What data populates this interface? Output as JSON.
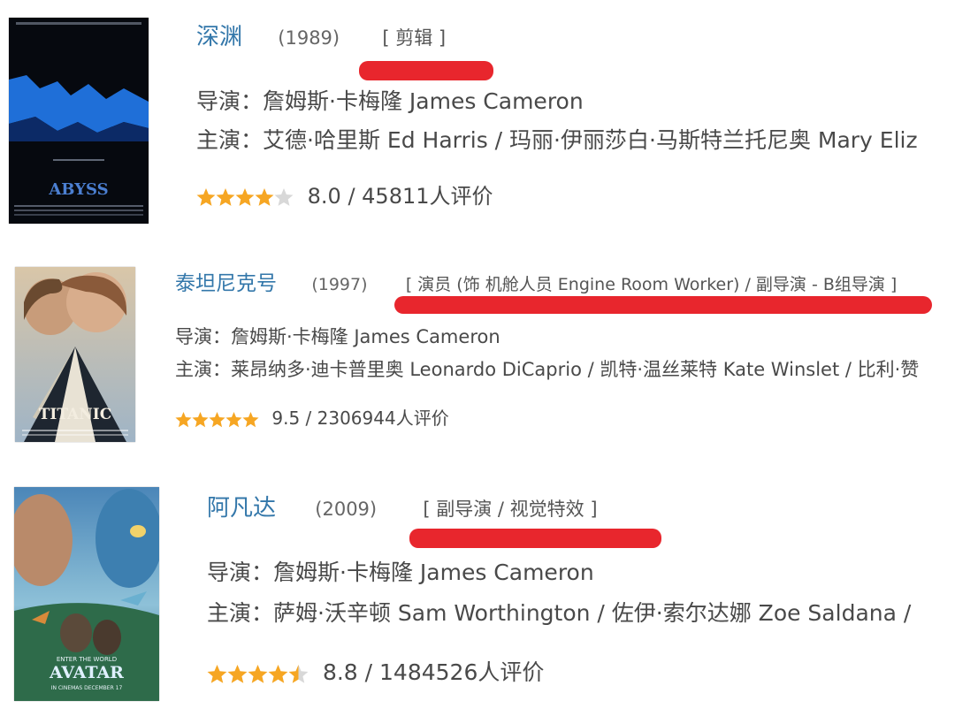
{
  "colors": {
    "title_link": "#3377aa",
    "star": "#f6a623",
    "star_empty": "#d8d8d8",
    "highlight": "#e8262d"
  },
  "movies": [
    {
      "title": "深渊",
      "year": "(1989)",
      "roles": "[ 剪辑 ]",
      "director_label": "导演：",
      "director": "詹姆斯·卡梅隆 James Cameron",
      "cast_label": "主演：",
      "cast": "艾德·哈里斯 Ed Harris / 玛丽·伊丽莎白·马斯特兰托尼奥 Mary Eliz",
      "rating_text": "8.0 / 45811人评价",
      "stars": 4,
      "poster_title": "ABYSS"
    },
    {
      "title": "泰坦尼克号",
      "year": "(1997)",
      "roles": "[ 演员 (饰 机舱人员 Engine Room Worker) / 副导演 - B组导演 ]",
      "director_label": "导演：",
      "director": "詹姆斯·卡梅隆 James Cameron",
      "cast_label": "主演：",
      "cast": "莱昂纳多·迪卡普里奥 Leonardo DiCaprio / 凯特·温丝莱特 Kate Winslet / 比利·赞",
      "rating_text": "9.5 / 2306944人评价",
      "stars": 5,
      "poster_title": "TITANIC"
    },
    {
      "title": "阿凡达",
      "year": "(2009)",
      "roles": "[ 副导演 / 视觉特效 ]",
      "director_label": "导演：",
      "director": "詹姆斯·卡梅隆 James Cameron",
      "cast_label": "主演：",
      "cast": "萨姆·沃辛顿 Sam Worthington / 佐伊·索尔达娜 Zoe Saldana /",
      "rating_text": "8.8 / 1484526人评价",
      "stars": 4.5,
      "poster_title": "AVATAR",
      "poster_top": "ENTER THE WORLD",
      "poster_bottom": "IN CINEMAS DECEMBER 17"
    }
  ]
}
